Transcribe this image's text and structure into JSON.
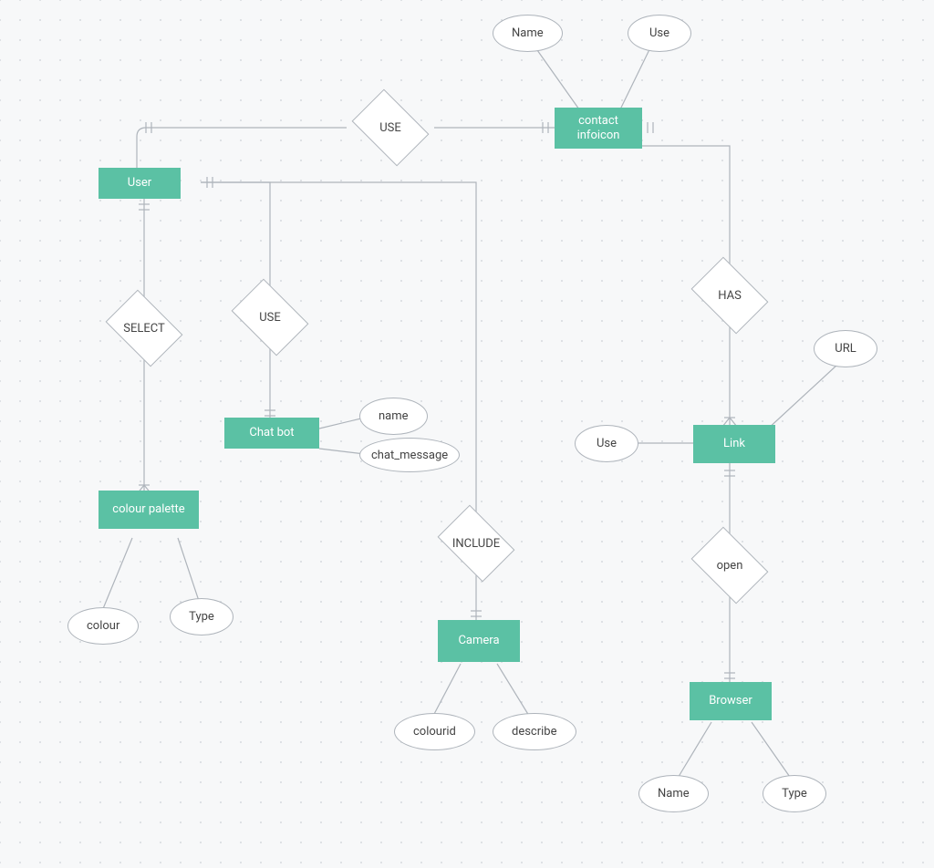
{
  "entities": {
    "user": "User",
    "contact_infoicon": "contact infoicon",
    "chat_bot": "Chat bot",
    "colour_palette": "colour palette",
    "camera": "Camera",
    "link": "Link",
    "browser": "Browser"
  },
  "relationships": {
    "use_user_contact": "USE",
    "select": "SELECT",
    "use_user_chatbot": "USE",
    "include": "INCLUDE",
    "has": "HAS",
    "open": "open"
  },
  "attributes": {
    "name_contact": "Name",
    "use_contact": "Use",
    "name_chatbot": "name",
    "chat_message": "chat_message",
    "colour": "colour",
    "type_palette": "Type",
    "colourid": "colourid",
    "describe": "describe",
    "use_link": "Use",
    "url": "URL",
    "name_browser": "Name",
    "type_browser": "Type"
  }
}
